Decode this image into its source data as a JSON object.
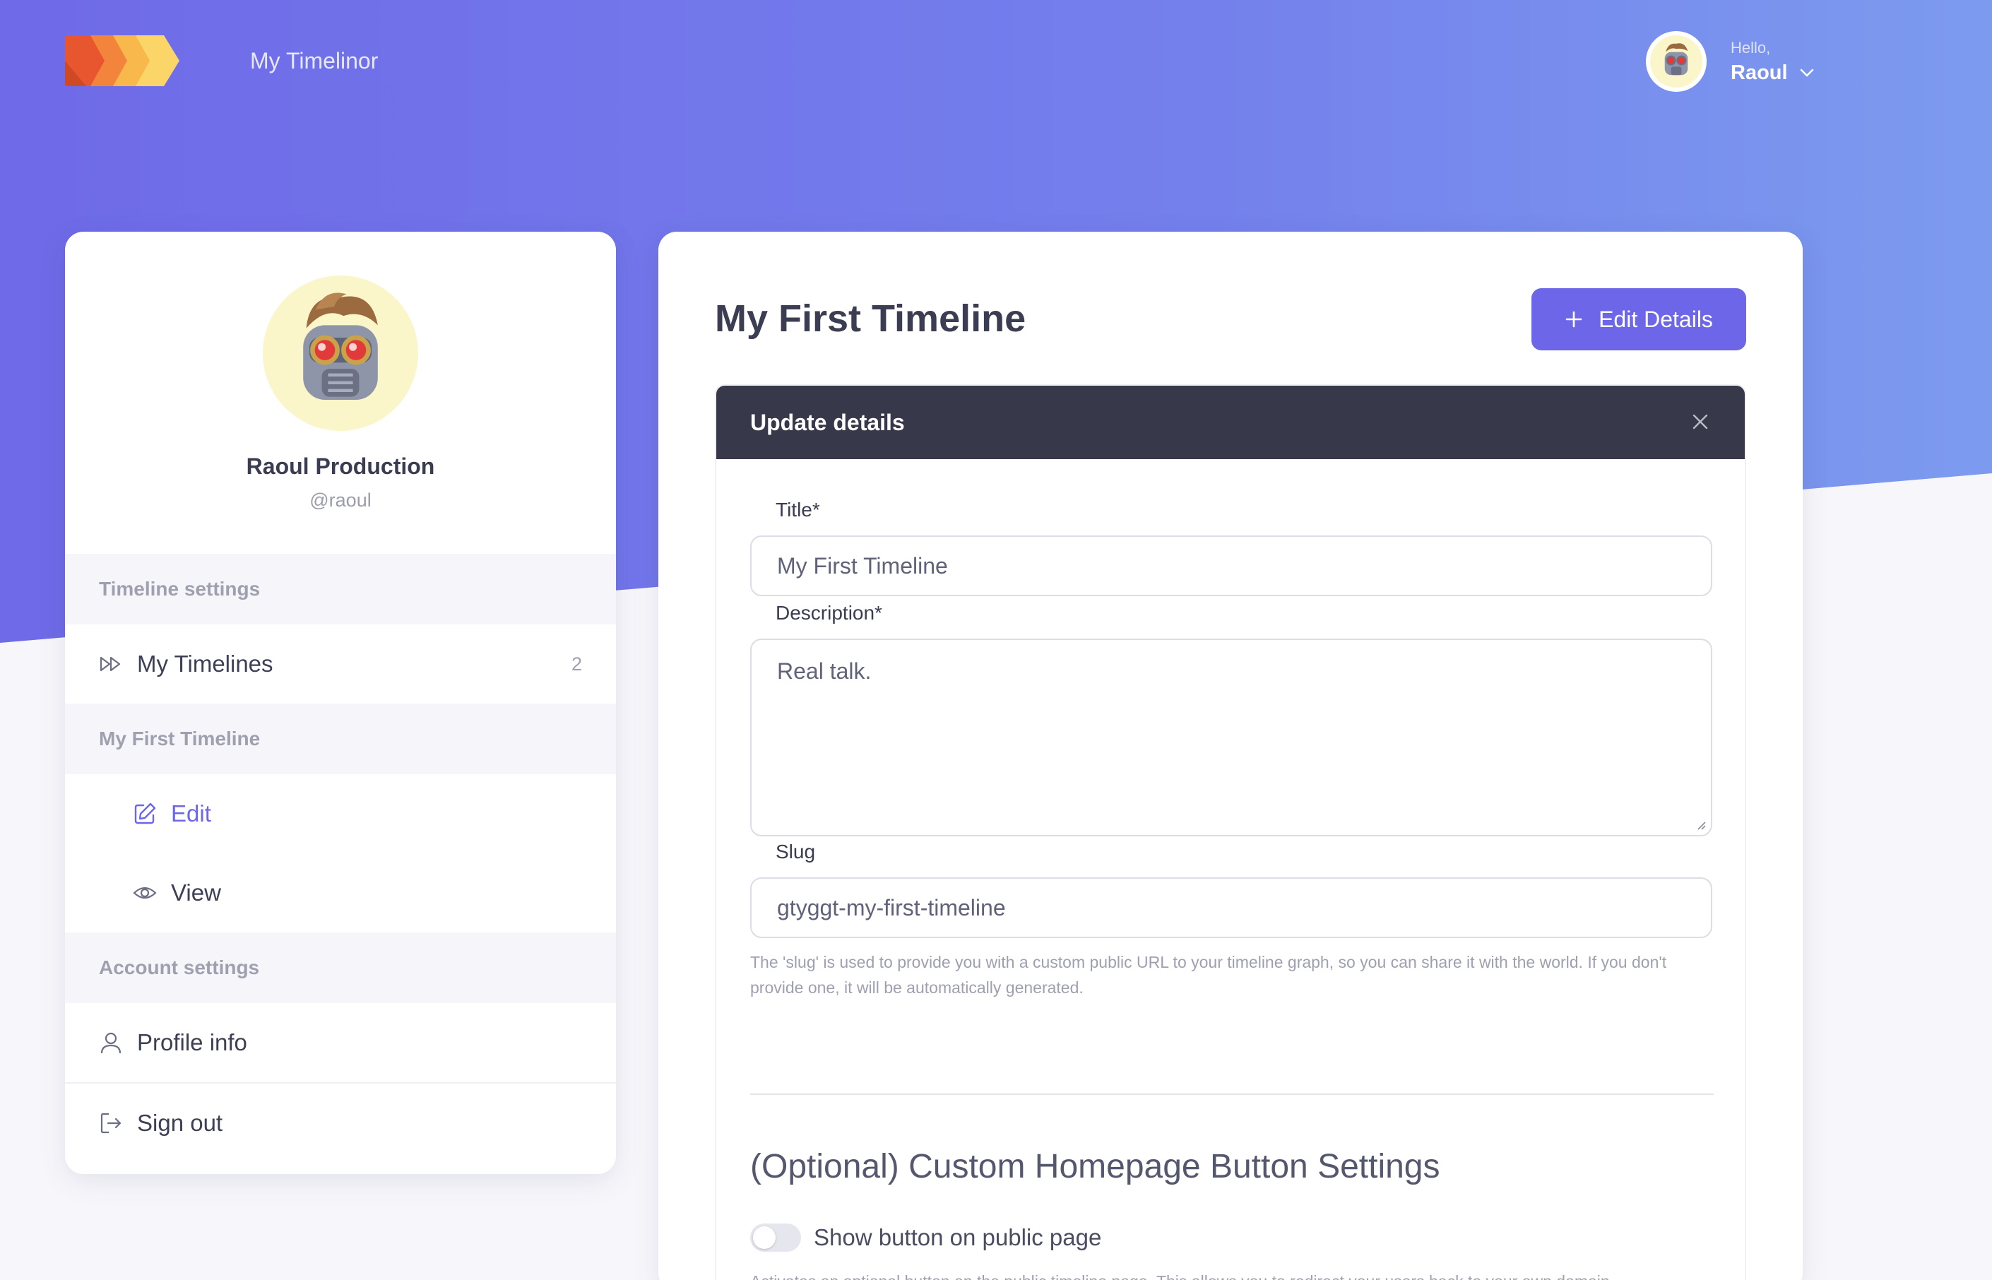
{
  "header": {
    "brand": "My Timelinor",
    "greeting": "Hello,",
    "user_name": "Raoul"
  },
  "profile": {
    "name": "Raoul Production",
    "handle": "@raoul"
  },
  "sidebar": {
    "timeline_settings_heading": "Timeline settings",
    "my_timelines_label": "My Timelines",
    "my_timelines_count": "2",
    "current_timeline_heading": "My First Timeline",
    "edit_label": "Edit",
    "view_label": "View",
    "account_settings_heading": "Account settings",
    "profile_info_label": "Profile info",
    "sign_out_label": "Sign out"
  },
  "main": {
    "title": "My First Timeline",
    "edit_details_label": "Edit Details"
  },
  "form": {
    "panel_title": "Update details",
    "title_label": "Title*",
    "title_value": "My First Timeline",
    "description_label": "Description*",
    "description_value": "Real talk.",
    "slug_label": "Slug",
    "slug_value": "gtyggt-my-first-timeline",
    "slug_help": "The 'slug' is used to provide you with a custom public URL to your timeline graph, so you can share it with the world. If you don't provide one, it will be automatically generated.",
    "optional_title": "(Optional) Custom Homepage Button Settings",
    "toggle_label": "Show button on public page",
    "toggle_on": false,
    "toggle_help": "Activates an optional button on the public timeline page. This allows you to redirect your users back to your own domain."
  },
  "colors": {
    "accent": "#6d66e8",
    "panel_header": "#373849",
    "gradient_start": "#6f6ae8",
    "gradient_end": "#7c9bef"
  },
  "icons": [
    "logo-icon",
    "chevron-down-icon",
    "fast-forward-icon",
    "edit-icon",
    "eye-icon",
    "user-icon",
    "sign-out-icon",
    "plus-icon",
    "close-icon"
  ]
}
